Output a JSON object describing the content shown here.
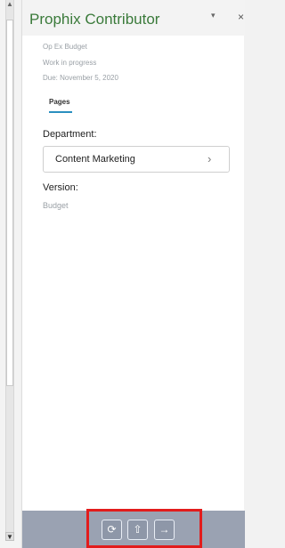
{
  "pane": {
    "title": "Prophix Contributor",
    "menu_icon": "▾",
    "close_icon": "×"
  },
  "meta": {
    "model": "Op Ex Budget",
    "status": "Work in progress",
    "due": "Due: November 5, 2020"
  },
  "tabs": {
    "pages": "Pages"
  },
  "department": {
    "label": "Department:",
    "value": "Content Marketing",
    "chevron": "›"
  },
  "version": {
    "label": "Version:",
    "value": "Budget"
  },
  "toolbar": {
    "refresh_icon": "⟳",
    "upload_icon": "⇧",
    "next_icon": "→"
  },
  "scroll": {
    "up": "▲",
    "down": "▼"
  },
  "colors": {
    "title": "#3a7a3a",
    "accent": "#2a8fbf",
    "toolbar": "#9aa2b2",
    "highlight": "#e21c1c"
  }
}
